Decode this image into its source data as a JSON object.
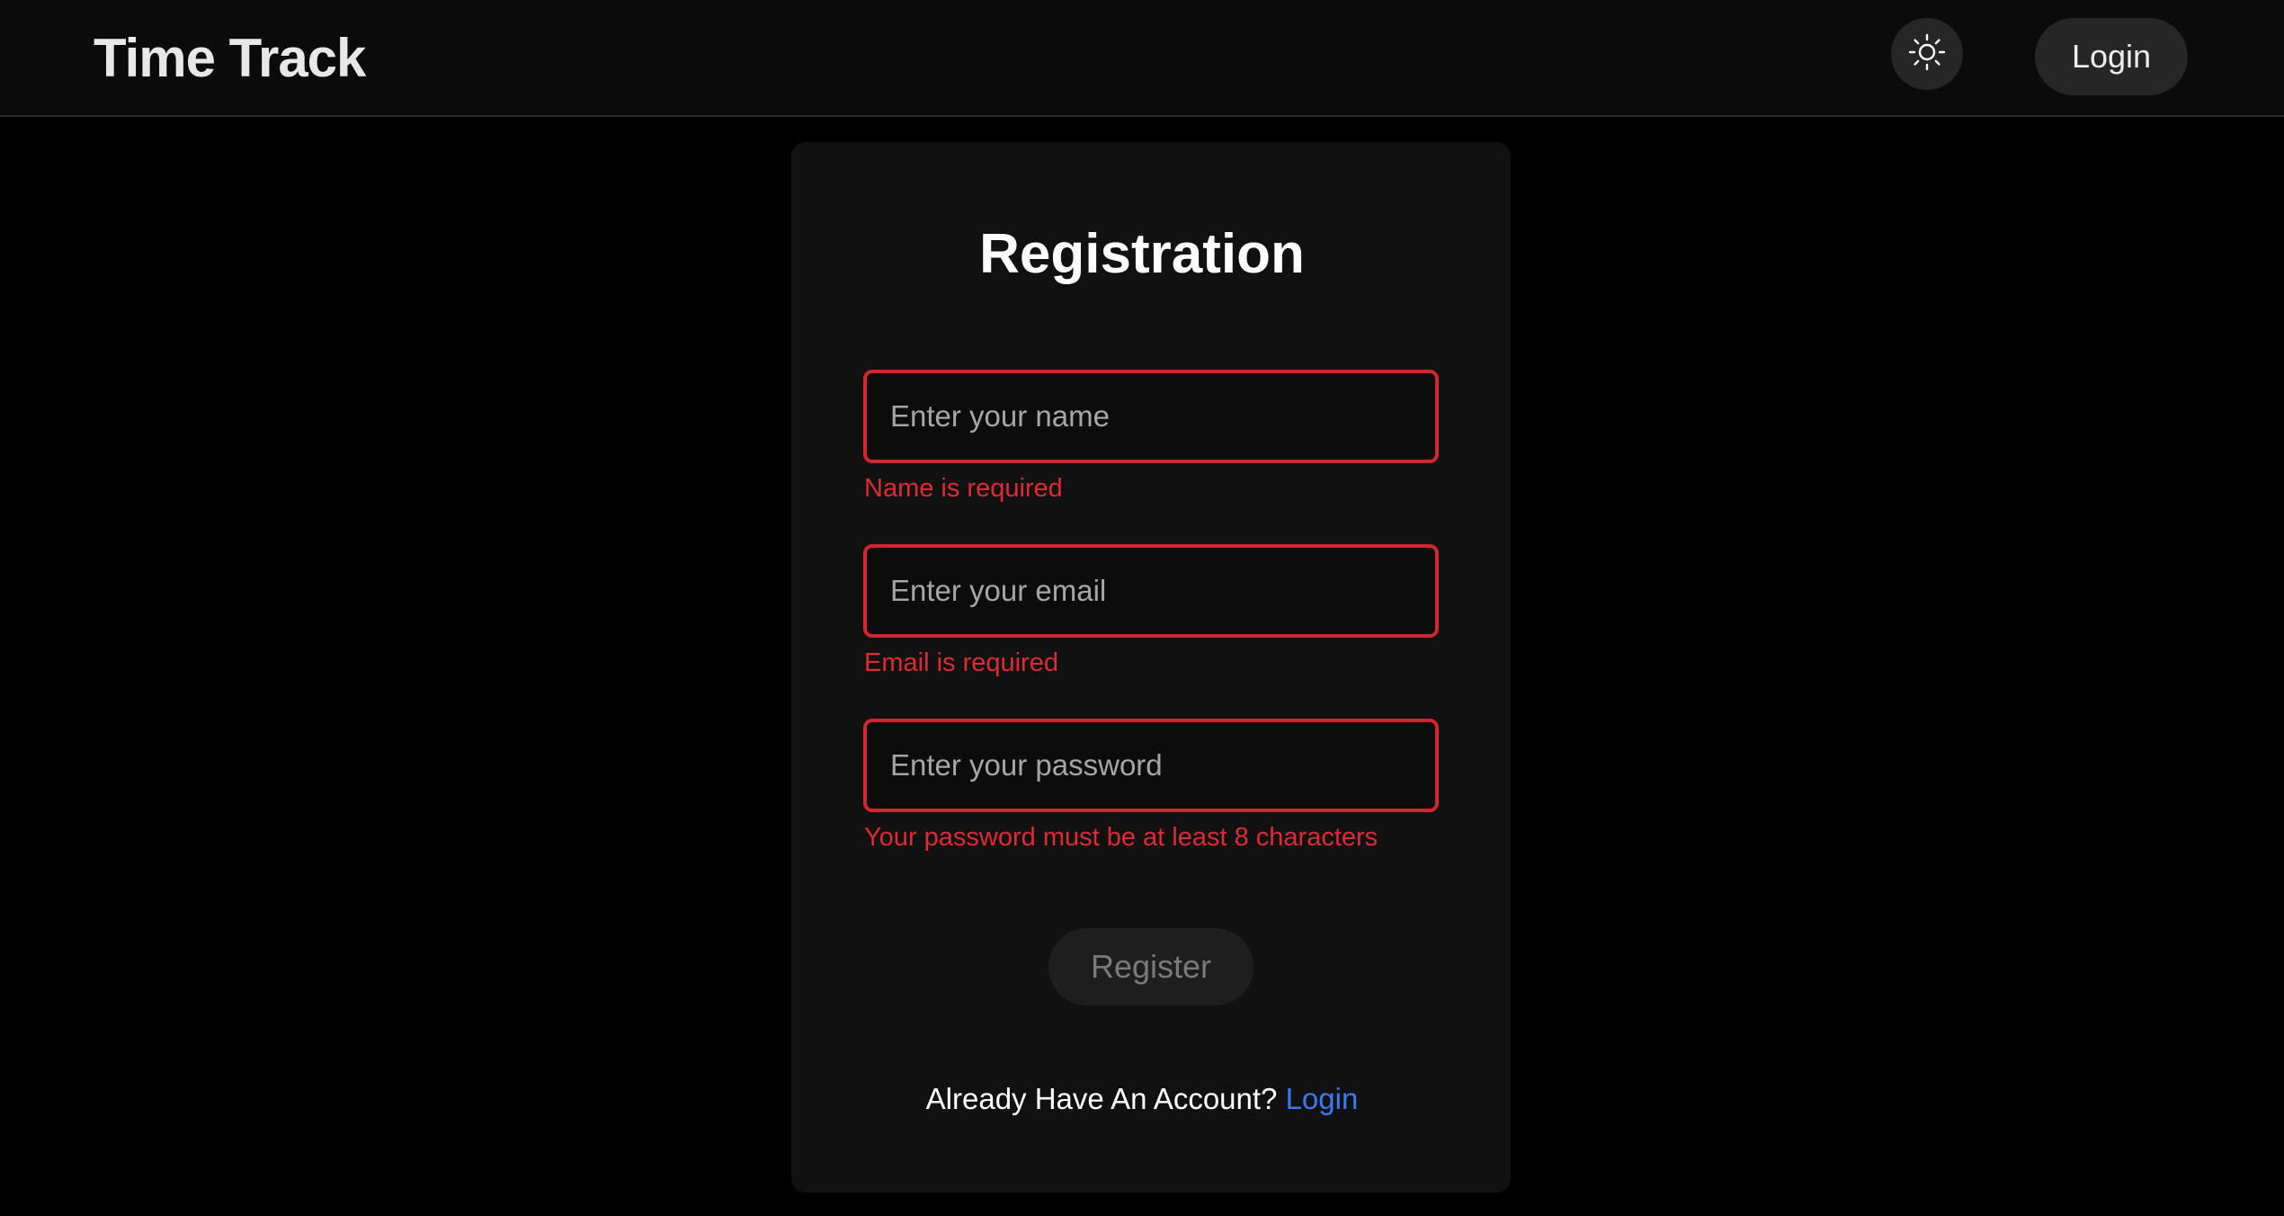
{
  "header": {
    "brand": "Time Track",
    "theme_toggle_icon": "sun-icon",
    "login_label": "Login"
  },
  "form": {
    "title": "Registration",
    "name": {
      "placeholder": "Enter your name",
      "value": "",
      "error": "Name is required"
    },
    "email": {
      "placeholder": "Enter your email",
      "value": "",
      "error": "Email is required"
    },
    "password": {
      "placeholder": "Enter your password",
      "value": "",
      "error": "Your password must be at least 8 characters"
    },
    "register_label": "Register",
    "footer_text": "Already Have An Account?",
    "footer_link": "Login"
  },
  "colors": {
    "background": "#000000",
    "card": "#111111",
    "error": "#e02a32",
    "link": "#3a7bf0"
  }
}
